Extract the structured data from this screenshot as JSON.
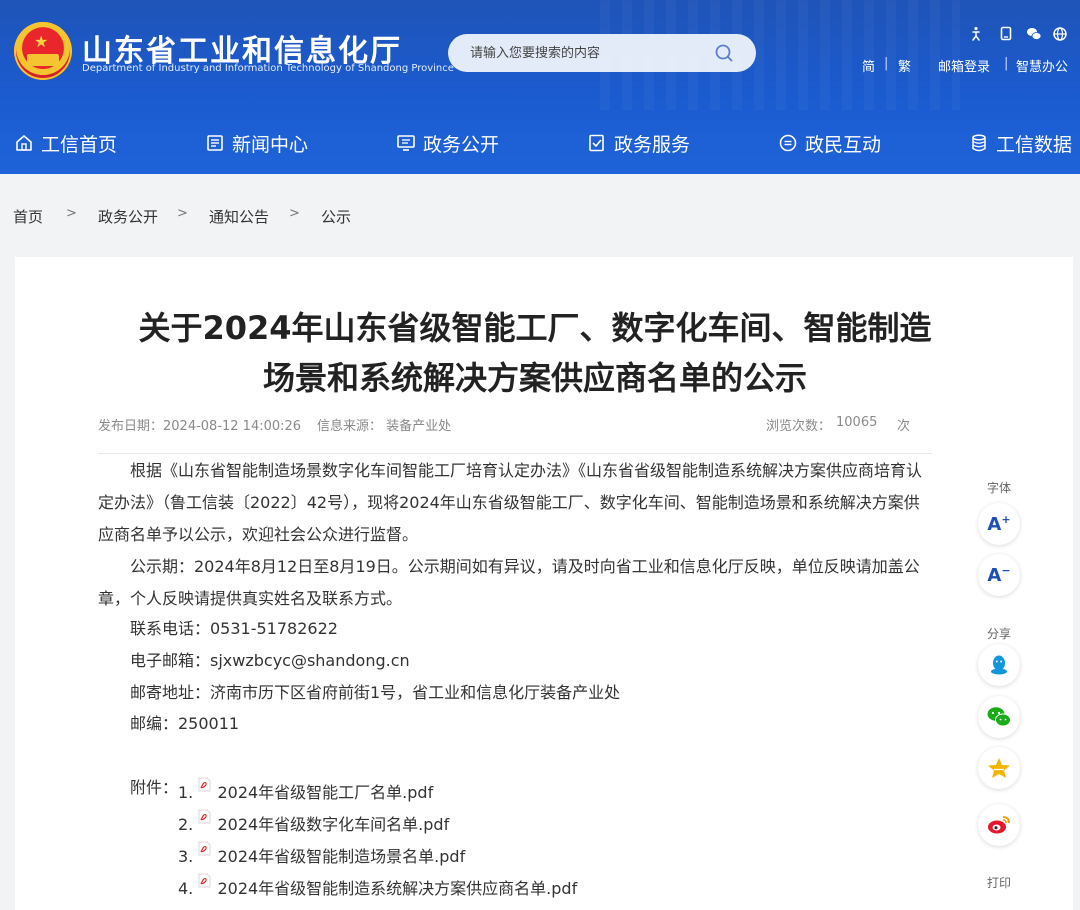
{
  "header": {
    "title": "山东省工业和信息化厅",
    "subtitle": "Department of Industry and Information Technology of Shandong Province",
    "search_placeholder": "请输入您要搜索的内容",
    "links": [
      "简",
      "繁",
      "邮箱登录",
      "智慧办公"
    ],
    "separator": "|"
  },
  "nav": {
    "items": [
      "工信首页",
      "新闻中心",
      "政务公开",
      "政务服务",
      "政民互动",
      "工信数据"
    ]
  },
  "breadcrumb": {
    "items": [
      "首页",
      "政务公开",
      "通知公告",
      "公示"
    ],
    "separator": ">"
  },
  "article": {
    "title_line1": "关于2024年山东省级智能工厂、数字化车间、智能制造",
    "title_line2": "场景和系统解决方案供应商名单的公示",
    "publish_date": "发布日期：2024-08-12 14:00:26",
    "source": "信息来源：  装备产业处",
    "views_label": "浏览次数：",
    "views_value": "10065",
    "views_unit": "次",
    "para1": "根据《山东省智能制造场景数字化车间智能工厂培育认定办法》《山东省省级智能制造系统解决方案供应商培育认定办法》（鲁工信装〔2022〕42号），现将2024年山东省级智能工厂、数字化车间、智能制造场景和系统解决方案供应商名单予以公示，欢迎社会公众进行监督。",
    "para2": "公示期：2024年8月12日至8月19日。公示期间如有异议，请及时向省工业和信息化厅反映，单位反映请加盖公章，个人反映请提供真实姓名及联系方式。",
    "phone": "联系电话：0531-51782622",
    "email": "电子邮箱：sjxwzbcyc@shandong.cn",
    "address": "邮寄地址：济南市历下区省府前街1号，省工业和信息化厅装备产业处",
    "postcode": "邮编：250011",
    "attachments_label": "附件：",
    "attachments": [
      {
        "num": "1.",
        "name": "2024年省级智能工厂名单.pdf"
      },
      {
        "num": "2.",
        "name": "2024年省级数字化车间名单.pdf"
      },
      {
        "num": "3.",
        "name": "2024年省级智能制造场景名单.pdf"
      },
      {
        "num": "4.",
        "name": "2024年省级智能制造系统解决方案供应商名单.pdf"
      }
    ]
  },
  "sidebar": {
    "font_label": "字体",
    "font_increase": "A",
    "font_increase_mark": "+",
    "font_decrease": "A",
    "font_decrease_mark": "−",
    "share_label": "分享",
    "print_label": "打印"
  },
  "colors": {
    "header_blue": "#1b5bd0",
    "brand_blue": "#1d4fb6",
    "qq": "#1296db",
    "wechat": "#1aad19",
    "favorite": "#f5b400",
    "weibo": "#e6162d"
  },
  "icons": [
    "home-icon",
    "news-icon",
    "monitor-icon",
    "service-icon",
    "chat-icon",
    "database-icon",
    "search-icon",
    "accessibility-icon",
    "mobile-icon",
    "wechat-icon",
    "globe-icon",
    "pdf-icon",
    "qq-icon",
    "star-icon",
    "weibo-icon"
  ]
}
